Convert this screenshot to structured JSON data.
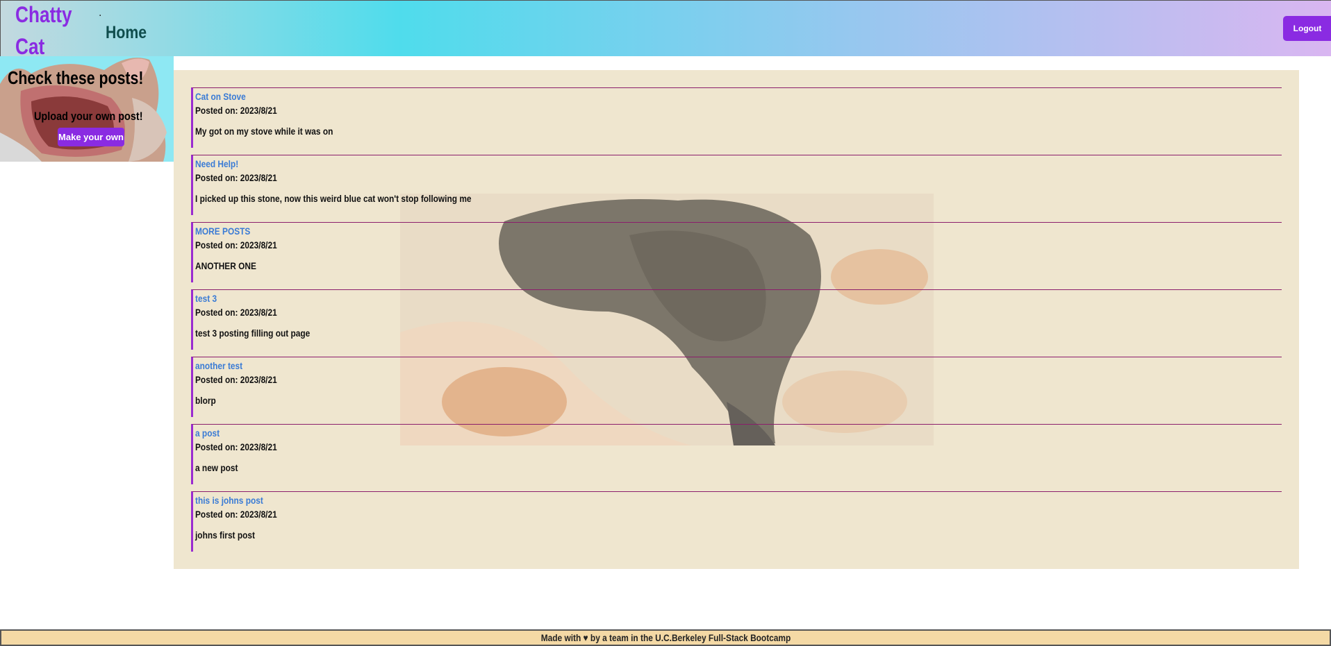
{
  "header": {
    "brand_line1": "Chatty",
    "brand_line2": "Cat",
    "nav_bullet": ".",
    "home_label": "Home",
    "logout_label": "Logout"
  },
  "sidebar": {
    "title": "Check these posts!",
    "upload_text": "Upload your own post!",
    "make_button": "Make your own"
  },
  "posts": [
    {
      "title": "Cat on Stove",
      "date": "Posted on: 2023/8/21",
      "body": "My got on my stove while it was on"
    },
    {
      "title": "Need Help!",
      "date": "Posted on: 2023/8/21",
      "body": "I picked up this stone, now this weird blue cat won't stop following me"
    },
    {
      "title": "MORE POSTS",
      "date": "Posted on: 2023/8/21",
      "body": "ANOTHER ONE"
    },
    {
      "title": "test 3",
      "date": "Posted on: 2023/8/21",
      "body": "test 3 posting filling out page"
    },
    {
      "title": "another test",
      "date": "Posted on: 2023/8/21",
      "body": "blorp"
    },
    {
      "title": "a post",
      "date": "Posted on: 2023/8/21",
      "body": "a new post"
    },
    {
      "title": "this is johns post",
      "date": "Posted on: 2023/8/21",
      "body": "johns first post"
    }
  ],
  "footer": {
    "text": "Made with ♥ by a team in the U.C.Berkeley Full-Stack Bootcamp"
  },
  "colors": {
    "accent": "#8a2be2",
    "home_link": "#0f4d4d",
    "post_title": "#3a7bd5",
    "panel_bg": "#efe6cf",
    "footer_bg": "#f4d9a5"
  }
}
